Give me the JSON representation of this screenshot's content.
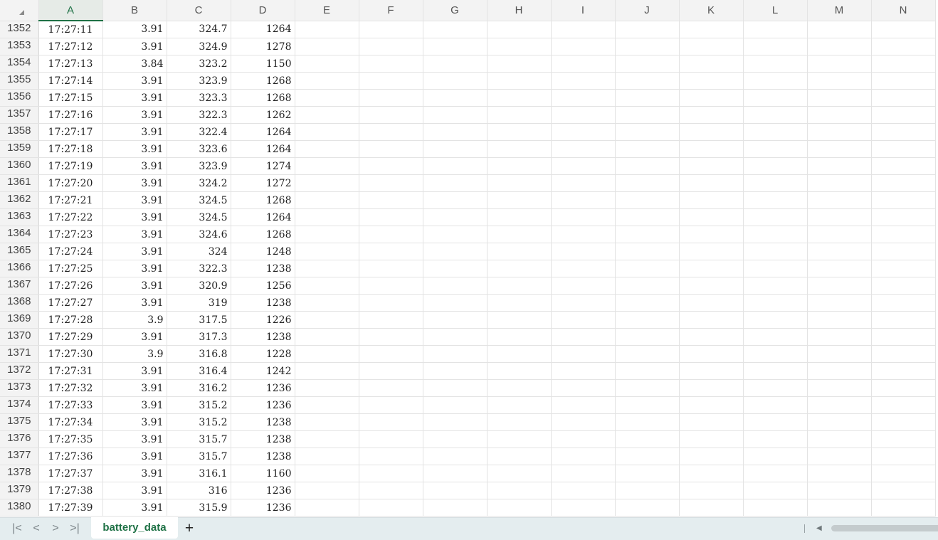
{
  "corner": {
    "icon": "select-all-triangle"
  },
  "columns": [
    "A",
    "B",
    "C",
    "D",
    "E",
    "F",
    "G",
    "H",
    "I",
    "J",
    "K",
    "L",
    "M",
    "N"
  ],
  "active_column": "A",
  "rows": [
    {
      "row": "1352",
      "a": "17:27:11",
      "b": "3.91",
      "c": "324.7",
      "d": "1264"
    },
    {
      "row": "1353",
      "a": "17:27:12",
      "b": "3.91",
      "c": "324.9",
      "d": "1278"
    },
    {
      "row": "1354",
      "a": "17:27:13",
      "b": "3.84",
      "c": "323.2",
      "d": "1150"
    },
    {
      "row": "1355",
      "a": "17:27:14",
      "b": "3.91",
      "c": "323.9",
      "d": "1268"
    },
    {
      "row": "1356",
      "a": "17:27:15",
      "b": "3.91",
      "c": "323.3",
      "d": "1268"
    },
    {
      "row": "1357",
      "a": "17:27:16",
      "b": "3.91",
      "c": "322.3",
      "d": "1262"
    },
    {
      "row": "1358",
      "a": "17:27:17",
      "b": "3.91",
      "c": "322.4",
      "d": "1264"
    },
    {
      "row": "1359",
      "a": "17:27:18",
      "b": "3.91",
      "c": "323.6",
      "d": "1264"
    },
    {
      "row": "1360",
      "a": "17:27:19",
      "b": "3.91",
      "c": "323.9",
      "d": "1274"
    },
    {
      "row": "1361",
      "a": "17:27:20",
      "b": "3.91",
      "c": "324.2",
      "d": "1272"
    },
    {
      "row": "1362",
      "a": "17:27:21",
      "b": "3.91",
      "c": "324.5",
      "d": "1268"
    },
    {
      "row": "1363",
      "a": "17:27:22",
      "b": "3.91",
      "c": "324.5",
      "d": "1264"
    },
    {
      "row": "1364",
      "a": "17:27:23",
      "b": "3.91",
      "c": "324.6",
      "d": "1268"
    },
    {
      "row": "1365",
      "a": "17:27:24",
      "b": "3.91",
      "c": "324",
      "d": "1248"
    },
    {
      "row": "1366",
      "a": "17:27:25",
      "b": "3.91",
      "c": "322.3",
      "d": "1238"
    },
    {
      "row": "1367",
      "a": "17:27:26",
      "b": "3.91",
      "c": "320.9",
      "d": "1256"
    },
    {
      "row": "1368",
      "a": "17:27:27",
      "b": "3.91",
      "c": "319",
      "d": "1238"
    },
    {
      "row": "1369",
      "a": "17:27:28",
      "b": "3.9",
      "c": "317.5",
      "d": "1226"
    },
    {
      "row": "1370",
      "a": "17:27:29",
      "b": "3.91",
      "c": "317.3",
      "d": "1238"
    },
    {
      "row": "1371",
      "a": "17:27:30",
      "b": "3.9",
      "c": "316.8",
      "d": "1228"
    },
    {
      "row": "1372",
      "a": "17:27:31",
      "b": "3.91",
      "c": "316.4",
      "d": "1242"
    },
    {
      "row": "1373",
      "a": "17:27:32",
      "b": "3.91",
      "c": "316.2",
      "d": "1236"
    },
    {
      "row": "1374",
      "a": "17:27:33",
      "b": "3.91",
      "c": "315.2",
      "d": "1236"
    },
    {
      "row": "1375",
      "a": "17:27:34",
      "b": "3.91",
      "c": "315.2",
      "d": "1238"
    },
    {
      "row": "1376",
      "a": "17:27:35",
      "b": "3.91",
      "c": "315.7",
      "d": "1238"
    },
    {
      "row": "1377",
      "a": "17:27:36",
      "b": "3.91",
      "c": "315.7",
      "d": "1238"
    },
    {
      "row": "1378",
      "a": "17:27:37",
      "b": "3.91",
      "c": "316.1",
      "d": "1160"
    },
    {
      "row": "1379",
      "a": "17:27:38",
      "b": "3.91",
      "c": "316",
      "d": "1236"
    },
    {
      "row": "1380",
      "a": "17:27:39",
      "b": "3.91",
      "c": "315.9",
      "d": "1236"
    }
  ],
  "tabbar": {
    "nav_first": "|<",
    "nav_prev": "<",
    "nav_next": ">",
    "nav_last": ">|",
    "sheet_name": "battery_data",
    "add_sheet": "+",
    "scroll_left": "◀"
  },
  "colors": {
    "accent": "#1e7145",
    "tabbar_bg": "#e4edef",
    "header_bg": "#f3f3f3"
  }
}
